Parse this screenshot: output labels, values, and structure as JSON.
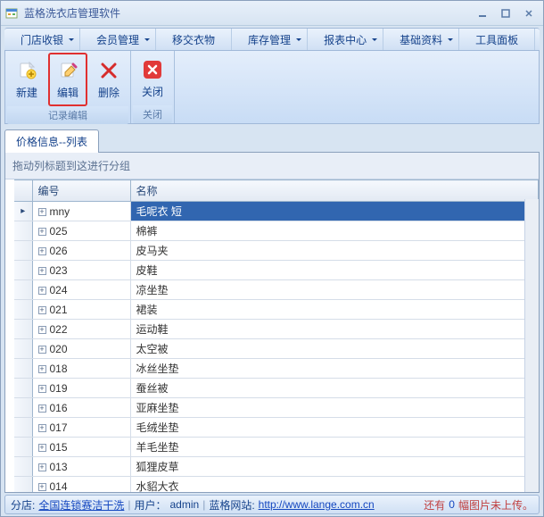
{
  "window": {
    "title": "蓝格洗衣店管理软件"
  },
  "menu": {
    "items": [
      "门店收银",
      "会员管理",
      "移交衣物",
      "库存管理",
      "报表中心",
      "基础资料",
      "工具面板"
    ]
  },
  "ribbon": {
    "group1": {
      "label": "记录编辑",
      "btn_new": "新建",
      "btn_edit": "编辑",
      "btn_delete": "删除"
    },
    "group2": {
      "label": "关闭",
      "btn_close": "关闭"
    }
  },
  "tab": {
    "label": "价格信息--列表"
  },
  "groupby": {
    "hint": "拖动列标题到这进行分组"
  },
  "grid": {
    "col_code": "编号",
    "col_name": "名称",
    "rows": [
      {
        "code": "mny",
        "name": "毛呢衣 短",
        "selected": true,
        "current": true
      },
      {
        "code": "025",
        "name": "棉裤"
      },
      {
        "code": "026",
        "name": "皮马夹"
      },
      {
        "code": "023",
        "name": "皮鞋"
      },
      {
        "code": "024",
        "name": "凉坐垫"
      },
      {
        "code": "021",
        "name": "裙装"
      },
      {
        "code": "022",
        "name": "运动鞋"
      },
      {
        "code": "020",
        "name": "太空被"
      },
      {
        "code": "018",
        "name": "冰丝坐垫"
      },
      {
        "code": "019",
        "name": "蚕丝被"
      },
      {
        "code": "016",
        "name": "亚麻坐垫"
      },
      {
        "code": "017",
        "name": "毛绒坐垫"
      },
      {
        "code": "015",
        "name": "羊毛坐垫"
      },
      {
        "code": "013",
        "name": "狐狸皮草"
      },
      {
        "code": "014",
        "name": "水貂大衣"
      }
    ]
  },
  "status": {
    "store_label": "分店: ",
    "store_value": "全国连锁赛洁干洗",
    "user_label": "用户：",
    "user_value": "admin",
    "site_label": "蓝格网站: ",
    "site_value": "http://www.lange.com.cn",
    "sep": " | ",
    "upload_prefix": "还有 ",
    "upload_count": "0",
    "upload_suffix": " 幅图片未上传。"
  }
}
